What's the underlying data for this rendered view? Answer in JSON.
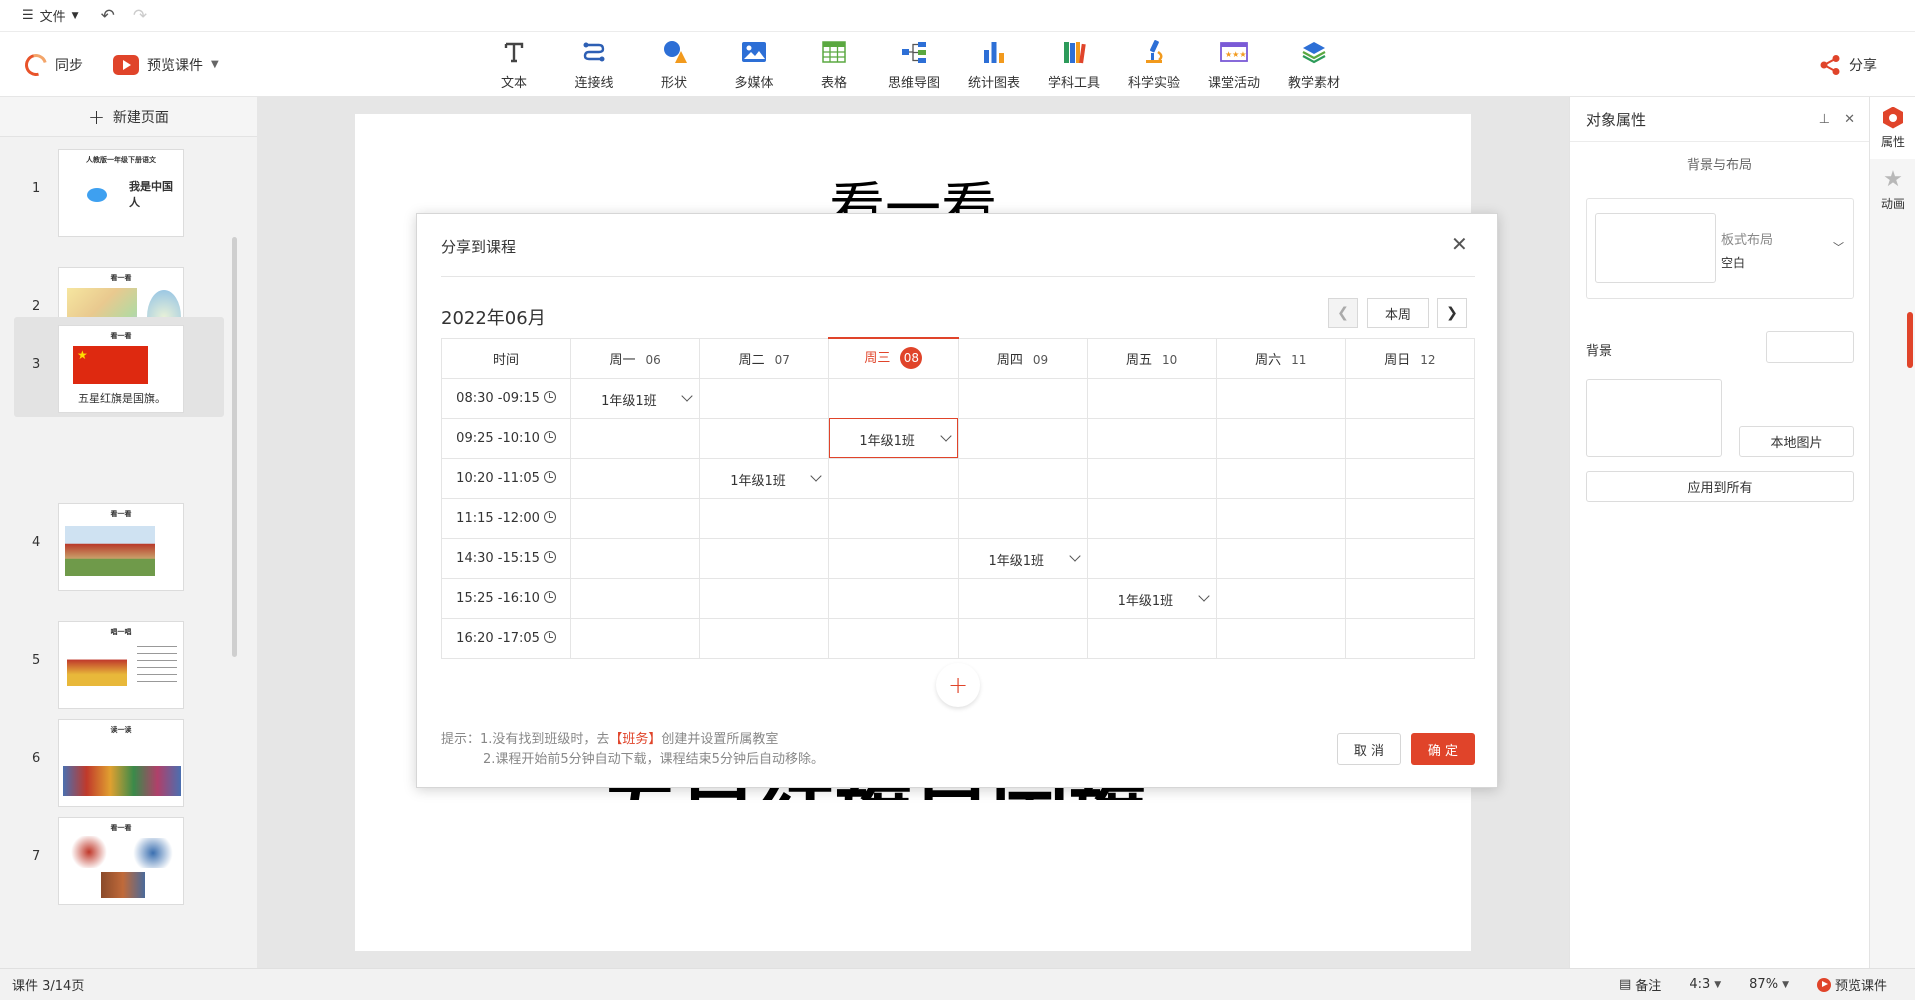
{
  "menubar": {
    "file_label": "文件"
  },
  "toolbar": {
    "sync_label": "同步",
    "preview_label": "预览课件",
    "tools": [
      {
        "label": "文本",
        "icon": "text-icon"
      },
      {
        "label": "连接线",
        "icon": "connector-icon"
      },
      {
        "label": "形状",
        "icon": "shape-icon"
      },
      {
        "label": "多媒体",
        "icon": "media-icon"
      },
      {
        "label": "表格",
        "icon": "table-icon"
      },
      {
        "label": "思维导图",
        "icon": "mindmap-icon"
      },
      {
        "label": "统计图表",
        "icon": "chart-icon"
      },
      {
        "label": "学科工具",
        "icon": "books-icon"
      },
      {
        "label": "科学实验",
        "icon": "microscope-icon"
      },
      {
        "label": "课堂活动",
        "icon": "activity-icon"
      },
      {
        "label": "教学素材",
        "icon": "materials-icon"
      }
    ],
    "share_label": "分享"
  },
  "left_panel": {
    "new_page_label": "新建页面",
    "slides": [
      {
        "num": "1",
        "title": "人教版一年级下册语文",
        "text": "我是中国人"
      },
      {
        "num": "2",
        "title": "看一看",
        "text": ""
      },
      {
        "num": "3",
        "title": "看一看",
        "text": "五星红旗是国旗。"
      },
      {
        "num": "4",
        "title": "看一看",
        "text": ""
      },
      {
        "num": "5",
        "title": "唱一唱",
        "text": ""
      },
      {
        "num": "6",
        "title": "读一读",
        "text": ""
      },
      {
        "num": "7",
        "title": "看一看",
        "text": ""
      }
    ]
  },
  "slide": {
    "title": "看一看",
    "body": "五星红旗是国旗。"
  },
  "right_panel": {
    "title": "对象属性",
    "section": "背景与布局",
    "layout_label": "板式布局",
    "layout_value": "空白",
    "background_label": "背景",
    "local_image_button": "本地图片",
    "apply_all_button": "应用到所有"
  },
  "vtabs": [
    {
      "label": "属性",
      "icon": "properties-icon"
    },
    {
      "label": "动画",
      "icon": "animation-icon"
    }
  ],
  "statusbar": {
    "pages": "课件 3/14页",
    "notes": "备注",
    "ratio": "4:3",
    "zoom": "87%",
    "preview": "预览课件"
  },
  "dialog": {
    "title": "分享到课程",
    "month": "2022年06月",
    "this_week_button": "本周",
    "header_time": "时间",
    "days": [
      {
        "name": "周一",
        "date": "06"
      },
      {
        "name": "周二",
        "date": "07"
      },
      {
        "name": "周三",
        "date": "08"
      },
      {
        "name": "周四",
        "date": "09"
      },
      {
        "name": "周五",
        "date": "10"
      },
      {
        "name": "周六",
        "date": "11"
      },
      {
        "name": "周日",
        "date": "12"
      }
    ],
    "today_index": 2,
    "rows": [
      {
        "time": "08:30 -09:15",
        "cells": [
          "1年级1班",
          "",
          "",
          "",
          "",
          "",
          ""
        ]
      },
      {
        "time": "09:25 -10:10",
        "cells": [
          "",
          "",
          "1年级1班",
          "",
          "",
          "",
          ""
        ]
      },
      {
        "time": "10:20 -11:05",
        "cells": [
          "",
          "1年级1班",
          "",
          "",
          "",
          "",
          ""
        ]
      },
      {
        "time": "11:15 -12:00",
        "cells": [
          "",
          "",
          "",
          "",
          "",
          "",
          ""
        ]
      },
      {
        "time": "14:30 -15:15",
        "cells": [
          "",
          "",
          "",
          "1年级1班",
          "",
          "",
          ""
        ]
      },
      {
        "time": "15:25 -16:10",
        "cells": [
          "",
          "",
          "",
          "",
          "1年级1班",
          "",
          ""
        ]
      },
      {
        "time": "16:20 -17:05",
        "cells": [
          "",
          "",
          "",
          "",
          "",
          "",
          ""
        ]
      }
    ],
    "selected_cell": {
      "row": 1,
      "col": 2
    },
    "tip_prefix": "提示：1.没有找到班级时，去",
    "tip_link": "【班务】",
    "tip_suffix": "创建并设置所属教室",
    "tip_line2": "2.课程开始前5分钟自动下载，课程结束5分钟后自动移除。",
    "cancel_button": "取 消",
    "confirm_button": "确 定"
  },
  "colors": {
    "accent": "#e0442a"
  }
}
